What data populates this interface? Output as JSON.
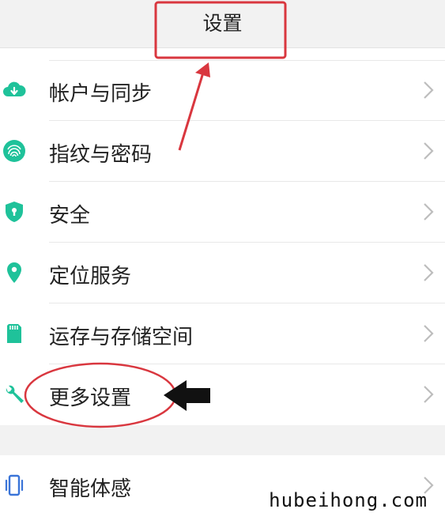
{
  "header": {
    "title": "设置"
  },
  "settings": {
    "items": [
      {
        "label": "帐户与同步",
        "icon": "cloud-icon"
      },
      {
        "label": "指纹与密码",
        "icon": "fingerprint-icon"
      },
      {
        "label": "安全",
        "icon": "shield-icon"
      },
      {
        "label": "定位服务",
        "icon": "location-pin-icon"
      },
      {
        "label": "运存与存储空间",
        "icon": "sd-card-icon"
      },
      {
        "label": "更多设置",
        "icon": "wrench-icon"
      }
    ],
    "group2": [
      {
        "label": "智能体感",
        "icon": "phone-vibrate-icon"
      }
    ]
  },
  "colors": {
    "accent": "#1fc29a",
    "annotation": "#d9373f",
    "chevron": "#bdbdbd"
  },
  "watermark": "hubeihong.com"
}
